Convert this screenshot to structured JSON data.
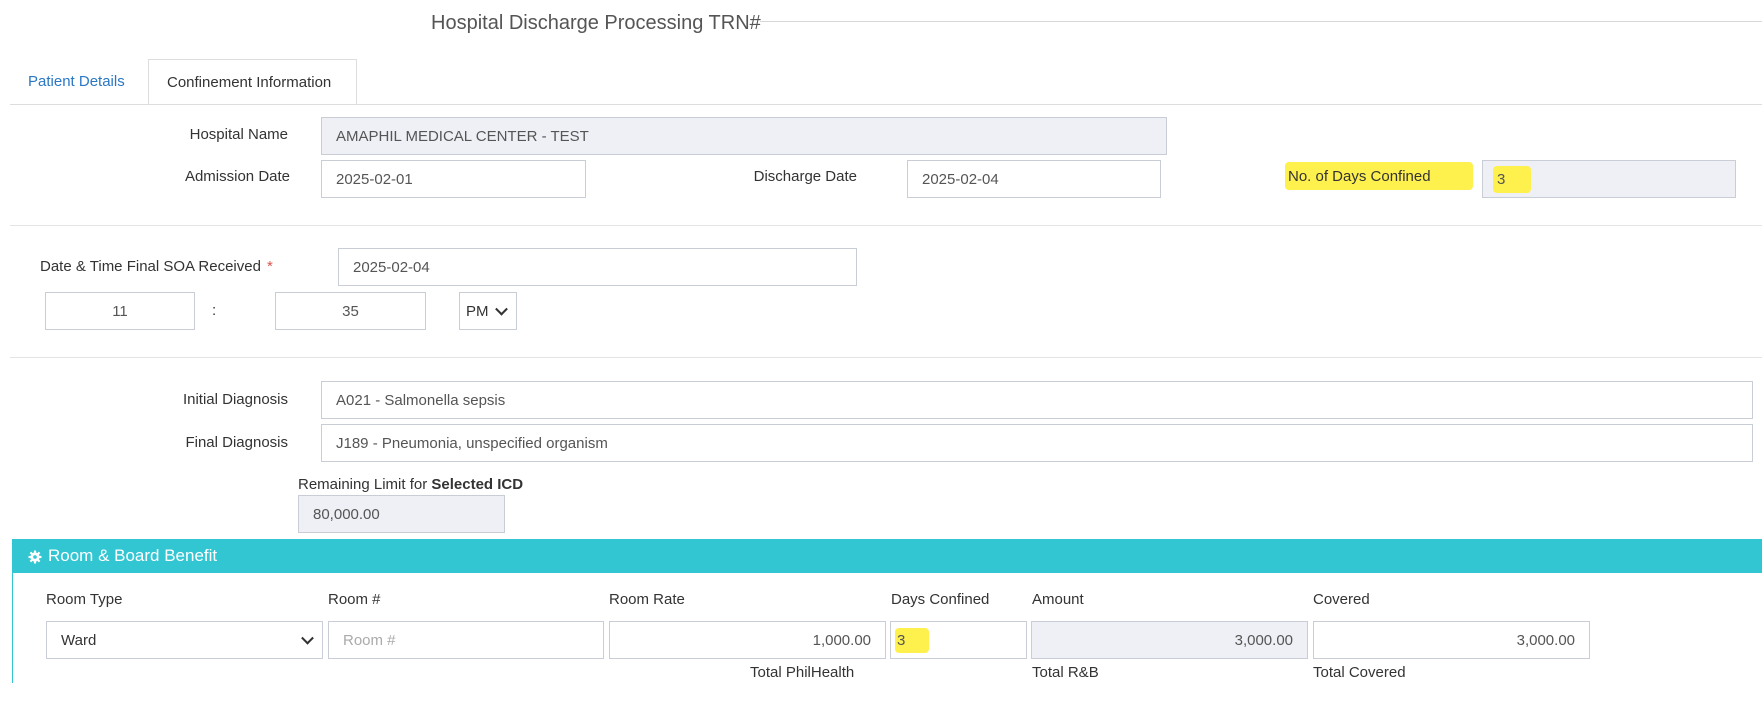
{
  "page": {
    "title": "Hospital Discharge Processing TRN#"
  },
  "tabs": [
    {
      "label": "Patient Details",
      "active": false
    },
    {
      "label": "Confinement Information",
      "active": true
    }
  ],
  "confinement": {
    "hospital_name_label": "Hospital Name",
    "hospital_name_value": "AMAPHIL MEDICAL CENTER - TEST",
    "admission_date_label": "Admission Date",
    "admission_date_value": "2025-02-01",
    "discharge_date_label": "Discharge Date",
    "discharge_date_value": "2025-02-04",
    "days_confined_label": "No. of Days Confined",
    "days_confined_value": "3"
  },
  "soa": {
    "label": "Date & Time Final SOA Received",
    "required_mark": "*",
    "date_value": "2025-02-04",
    "hour_value": "11",
    "separator": ":",
    "minute_value": "35",
    "ampm_value": "PM"
  },
  "diagnosis": {
    "initial_label": "Initial Diagnosis",
    "initial_value": "A021 - Salmonella sepsis",
    "final_label": "Final Diagnosis",
    "final_value": "J189 - Pneumonia, unspecified organism",
    "remaining_label_prefix": "Remaining Limit for ",
    "remaining_label_bold": "Selected ICD",
    "remaining_value": "80,000.00"
  },
  "room_board": {
    "section_title": "Room & Board Benefit",
    "headers": {
      "room_type": "Room Type",
      "room_no": "Room #",
      "room_rate": "Room Rate",
      "days_confined": "Days Confined",
      "amount": "Amount",
      "covered": "Covered"
    },
    "row": {
      "room_type": "Ward",
      "room_no_placeholder": "Room #",
      "room_rate": "1,000.00",
      "days_confined": "3",
      "amount": "3,000.00",
      "covered": "3,000.00"
    },
    "footer": {
      "total_philhealth": "Total PhilHealth",
      "total_rb": "Total R&B",
      "total_covered": "Total Covered"
    }
  },
  "colors": {
    "accent": "#32c5d2",
    "link": "#2a77c4",
    "highlight": "#fff14d",
    "readonly_bg": "#eef0f5"
  }
}
